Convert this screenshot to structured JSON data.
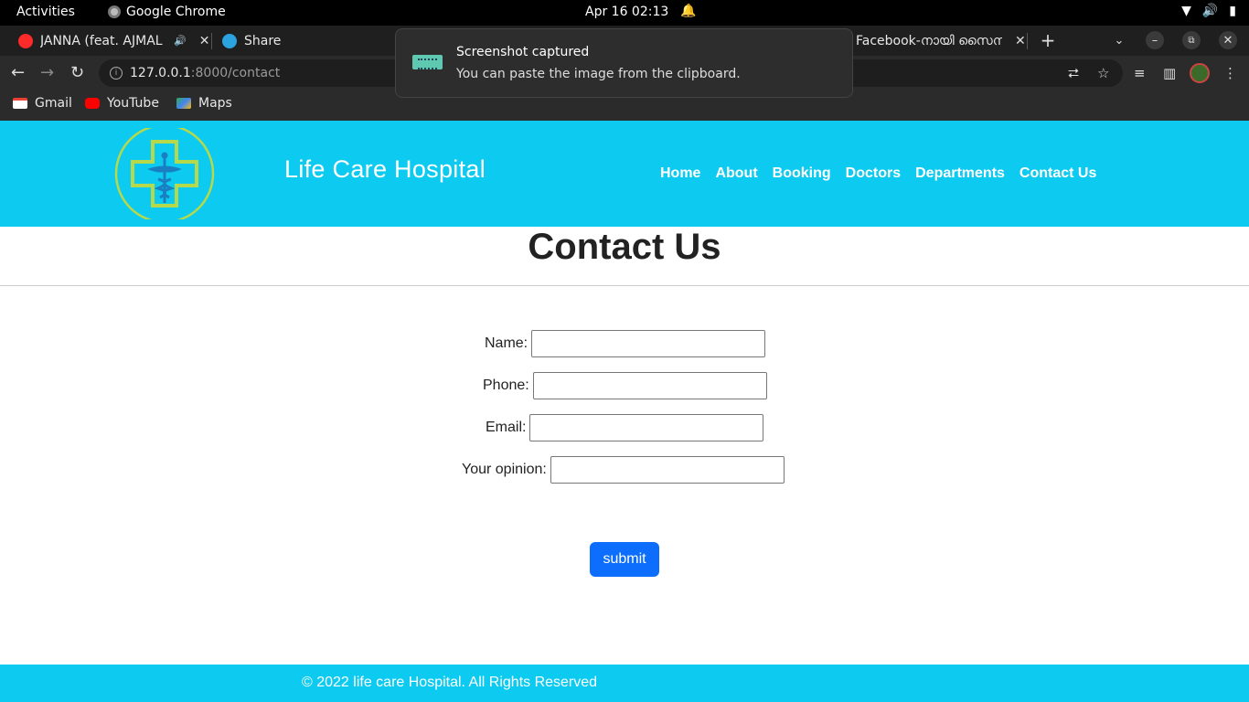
{
  "system": {
    "activities": "Activities",
    "app_name": "Google Chrome",
    "clock": "Apr 16  02:13"
  },
  "tabs": [
    {
      "title": "JANNA (feat. AJMAL",
      "favicon": "youtube-music-icon",
      "audio": true
    },
    {
      "title": "Share",
      "favicon": "telegram-icon"
    },
    {
      "title": "Facebook-നായി സൈന",
      "favicon": "facebook-icon"
    }
  ],
  "toolbar": {
    "url_host": "127.0.0.1",
    "url_path": ":8000/contact"
  },
  "bookmarks": [
    {
      "label": "Gmail",
      "icon": "gmail-icon"
    },
    {
      "label": "YouTube",
      "icon": "youtube-icon"
    },
    {
      "label": "Maps",
      "icon": "maps-icon"
    }
  ],
  "toast": {
    "title": "Screenshot captured",
    "body": "You can paste the image from the clipboard."
  },
  "site": {
    "brand": "Life Care Hospital",
    "nav": [
      "Home",
      "About",
      "Booking",
      "Doctors",
      "Departments",
      "Contact Us"
    ],
    "accent": "#0dcaf0"
  },
  "page": {
    "title": "Contact Us",
    "form": {
      "fields": [
        {
          "label": "Name:",
          "value": ""
        },
        {
          "label": "Phone:",
          "value": ""
        },
        {
          "label": "Email:",
          "value": ""
        },
        {
          "label": "Your opinion:",
          "value": ""
        }
      ],
      "submit_label": "submit",
      "submit_color": "#0d6efd"
    }
  },
  "footer": {
    "text": "© 2022 life care Hospital. All Rights Reserved"
  }
}
